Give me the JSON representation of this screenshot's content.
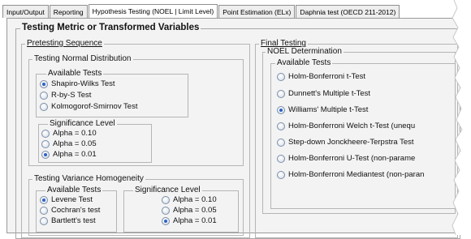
{
  "tabs": [
    {
      "label": "Input/Output",
      "active": false
    },
    {
      "label": "Reporting",
      "active": false
    },
    {
      "label": "Hypothesis Testing (NOEL | Limit Level)",
      "active": true
    },
    {
      "label": "Point Estimation (ELx)",
      "active": false
    },
    {
      "label": "Daphnia test (OECD 211-2012)",
      "active": false
    }
  ],
  "main_group": "Testing Metric or Transformed Variables",
  "pretesting": {
    "title": "Pretesting Sequence",
    "normal": {
      "title": "Testing Normal Distribution",
      "available_title": "Available Tests",
      "tests": [
        {
          "label": "Shapiro-Wilks Test",
          "checked": true
        },
        {
          "label": "R-by-S Test",
          "checked": false
        },
        {
          "label": "Kolmogorof-Smirnov Test",
          "checked": false
        }
      ],
      "significance_title": "Significance Level",
      "levels": [
        {
          "label": "Alpha = 0.10",
          "checked": false
        },
        {
          "label": "Alpha = 0.05",
          "checked": false
        },
        {
          "label": "Alpha = 0.01",
          "checked": true
        }
      ]
    },
    "variance": {
      "title": "Testing Variance Homogeneity",
      "available_title": "Available Tests",
      "tests": [
        {
          "label": "Levene Test",
          "checked": true
        },
        {
          "label": "Cochran's test",
          "checked": false
        },
        {
          "label": "Bartlett's test",
          "checked": false
        }
      ],
      "significance_title": "Significance Level",
      "levels": [
        {
          "label": "Alpha = 0.10",
          "checked": false
        },
        {
          "label": "Alpha = 0.05",
          "checked": false
        },
        {
          "label": "Alpha = 0.01",
          "checked": true
        }
      ]
    }
  },
  "final": {
    "title": "Final Testing",
    "noel_title": "NOEL Determination",
    "available_title": "Available Tests",
    "tests": [
      {
        "label": "Holm-Bonferroni t-Test",
        "checked": false
      },
      {
        "label": "Dunnett's Multiple t-Test",
        "checked": false
      },
      {
        "label": "Williams' Multiple t-Test",
        "checked": true
      },
      {
        "label": "Holm-Bonferroni Welch t-Test (unequ",
        "checked": false
      },
      {
        "label": "Step-down Jonckheere-Terpstra Test",
        "checked": false
      },
      {
        "label": "Holm-Bonferroni U-Test (non-parame",
        "checked": false
      },
      {
        "label": "Holm-Bonferroni Mediantest (non-paran",
        "checked": false
      }
    ]
  }
}
